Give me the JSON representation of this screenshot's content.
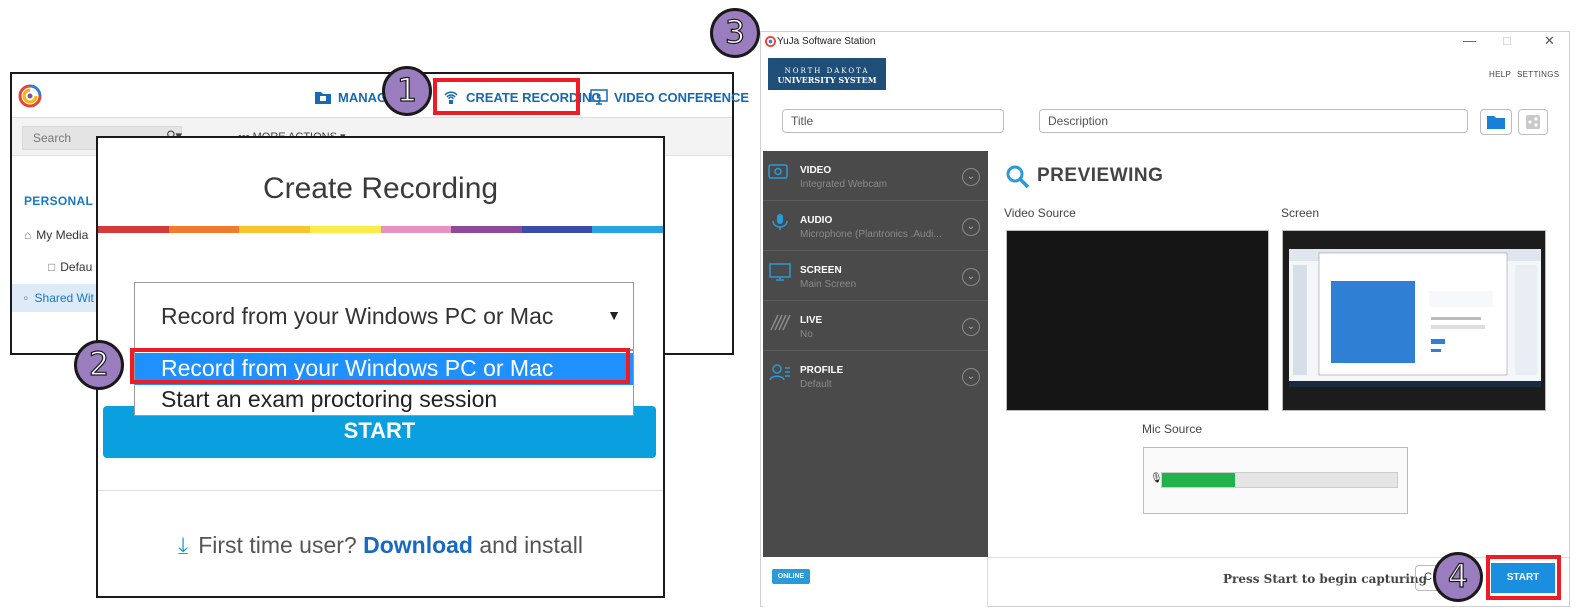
{
  "web": {
    "nav": {
      "manage": "MANAG",
      "create_recording": "CREATE RECORDING",
      "video_conference": "VIDEO CONFERENCE"
    },
    "search_placeholder": "Search",
    "more_actions": "••• MORE ACTIONS ▾",
    "section_title": "PERSONAL",
    "sidebar": [
      {
        "label": "My Media"
      },
      {
        "label": "Defau"
      },
      {
        "label": "Shared Wit"
      }
    ]
  },
  "modal": {
    "title": "Create Recording",
    "selected_value": "Record from your Windows PC or Mac",
    "options": [
      "Record from your Windows PC or Mac",
      "Start an exam proctoring session"
    ],
    "start_label": "START",
    "footer_text": "First time user?",
    "download_link": "Download",
    "footer_suffix": "and install",
    "rainbow_colors": [
      "#d43a3a",
      "#f07b2d",
      "#f8c52d",
      "#f9ec4b",
      "#e892c2",
      "#8d4a9a",
      "#3b4ba8",
      "#29a3de"
    ]
  },
  "app": {
    "window_title": "YuJa Software Station",
    "banner_line1": "NORTH DAKOTA",
    "banner_line2": "UNIVERSITY SYSTEM",
    "help": "HELP",
    "settings": "SETTINGS",
    "title_placeholder": "Title",
    "description_placeholder": "Description",
    "sources": [
      {
        "name": "VIDEO",
        "value": "Integrated Webcam"
      },
      {
        "name": "AUDIO",
        "value": "Microphone (Plantronics .Audi..."
      },
      {
        "name": "SCREEN",
        "value": "Main Screen"
      },
      {
        "name": "LIVE",
        "value": "No"
      },
      {
        "name": "PROFILE",
        "value": "Default"
      }
    ],
    "previewing": "PREVIEWING",
    "video_source_label": "Video Source",
    "screen_label": "Screen",
    "mic_source_label": "Mic Source",
    "mic_level": 0.31,
    "online": "ONLINE",
    "press_start": "Press Start to begin capturing",
    "cancel_label": "C",
    "start_label": "START"
  },
  "annotations": {
    "step1": "1",
    "step2": "2",
    "step3": "3",
    "step4": "4",
    "highlight_color": "#ee1c25",
    "badge_color": "#9a7dbf"
  }
}
